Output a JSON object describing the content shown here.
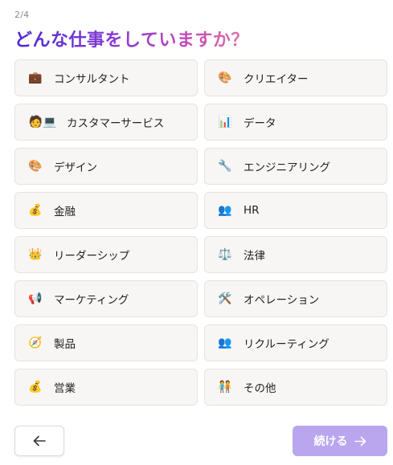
{
  "header": {
    "step": "2/4",
    "title": "どんな仕事をしていますか？"
  },
  "options": [
    {
      "label": "コンサルタント",
      "icon": "💼",
      "icon_name": "briefcase-icon"
    },
    {
      "label": "クリエイター",
      "icon": "🎨",
      "icon_name": "palette-icon"
    },
    {
      "label": "カスタマーサービス",
      "icon": "🧑💻",
      "icon_name": "person-laptop-icon"
    },
    {
      "label": "データ",
      "icon": "📊",
      "icon_name": "bar-chart-icon"
    },
    {
      "label": "デザイン",
      "icon": "🎨",
      "icon_name": "palette-icon"
    },
    {
      "label": "エンジニアリング",
      "icon": "🔧",
      "icon_name": "wrench-icon"
    },
    {
      "label": "金融",
      "icon": "💰",
      "icon_name": "money-bag-icon"
    },
    {
      "label": "HR",
      "icon": "👥",
      "icon_name": "people-icon"
    },
    {
      "label": "リーダーシップ",
      "icon": "👑",
      "icon_name": "crown-icon"
    },
    {
      "label": "法律",
      "icon": "⚖️",
      "icon_name": "scales-icon"
    },
    {
      "label": "マーケティング",
      "icon": "📢",
      "icon_name": "megaphone-icon"
    },
    {
      "label": "オペレーション",
      "icon": "🛠️",
      "icon_name": "tools-icon"
    },
    {
      "label": "製品",
      "icon": "🧭",
      "icon_name": "compass-icon"
    },
    {
      "label": "リクルーティング",
      "icon": "👥",
      "icon_name": "people-icon"
    },
    {
      "label": "営業",
      "icon": "💰",
      "icon_name": "money-bag-icon"
    },
    {
      "label": "その他",
      "icon": "🧑‍🤝‍🧑",
      "icon_name": "people-holding-hands-icon"
    }
  ],
  "footer": {
    "back_icon": "←",
    "next_label": "続ける",
    "next_icon": "→"
  },
  "colors": {
    "accent_button": "#b9a6ef",
    "option_background": "#f7f6f5",
    "title_gradient_start": "#4a2bd0",
    "title_gradient_end": "#e07aa8"
  }
}
